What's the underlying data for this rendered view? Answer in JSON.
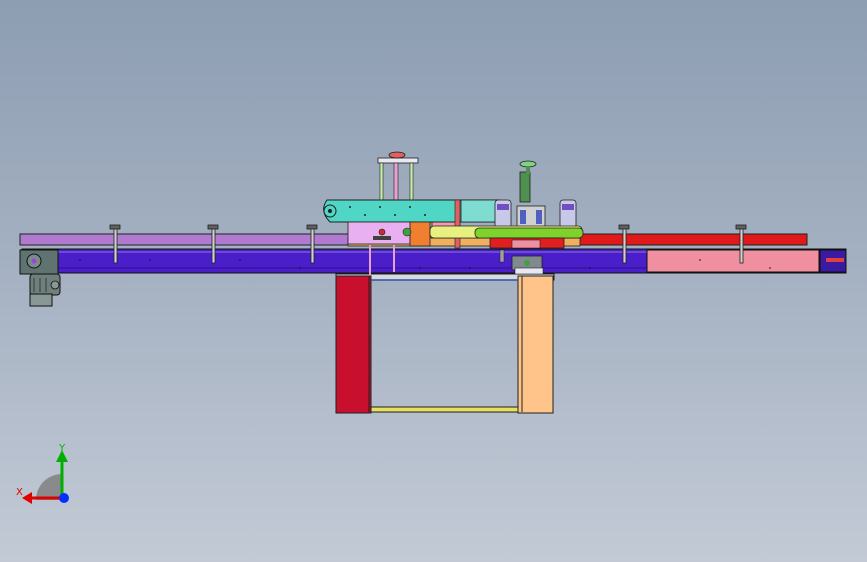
{
  "window": {
    "background_top": "#8d9db2",
    "background_bottom": "#c3cad6"
  },
  "model": {
    "parts": {
      "conveyor_frame": "#4a1fc9",
      "left_guide_rail": "#b07ad0",
      "right_guide_rail": "#e01a1a",
      "discharge_section": "#f08fa0",
      "drive_motor": "#6f7f7c",
      "stand_left_leg": "#c8102e",
      "stand_right_leg": "#ffc48a",
      "stand_crossbar": "#e8e060",
      "labeling_head": "#4fd6c4",
      "label_roll_plate": "#f39ab0",
      "bottle_turret": "#7ed22b",
      "turret_base": "#e02020",
      "upper_mast": "#c8f0a8",
      "guide_post": "#4f8f4f"
    }
  },
  "triad": {
    "x_label": "X",
    "y_label": "Y",
    "x_color": "#e00000",
    "y_color": "#00b000",
    "z_color": "#0030ff",
    "origin_color": "#808080"
  },
  "icons": {
    "triad": "reference-triad-icon",
    "motor": "drive-motor-icon"
  }
}
